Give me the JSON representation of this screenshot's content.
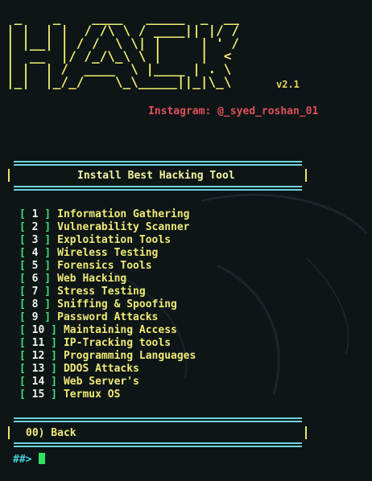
{
  "banner": {
    "ascii_lines": [
      " _    _    ____   _____  _  __",
      "| |  | |  / /\\ \\ / ____|| |/ /",
      "| |__| | / /  \\ \\| |     | ' / ",
      "|  __  |/ /_/\\_\\ \\ |     |  <  ",
      "| |  | /  ____  \\ |____ | . \\ ",
      "|_|  |_/_/    \\_\\_____||_|\\_\\"
    ],
    "version": "v2.1",
    "instagram": "Instagram: @_syed_roshan_01"
  },
  "header": {
    "title": "Install Best Hacking Tool"
  },
  "menu": {
    "items": [
      {
        "num": "1",
        "label": "Information Gathering"
      },
      {
        "num": "2",
        "label": "Vulnerability Scanner"
      },
      {
        "num": "3",
        "label": "Exploitation Tools"
      },
      {
        "num": "4",
        "label": "Wireless Testing"
      },
      {
        "num": "5",
        "label": "Forensics Tools"
      },
      {
        "num": "6",
        "label": "Web Hacking"
      },
      {
        "num": "7",
        "label": "Stress Testing"
      },
      {
        "num": "8",
        "label": "Sniffing & Spoofing"
      },
      {
        "num": "9",
        "label": "Password Attacks"
      },
      {
        "num": "10",
        "label": "Maintaining Access"
      },
      {
        "num": "11",
        "label": "IP-Tracking tools"
      },
      {
        "num": "12",
        "label": "Programming Languages"
      },
      {
        "num": "13",
        "label": "DDOS Attacks"
      },
      {
        "num": "14",
        "label": "Web Server's"
      },
      {
        "num": "15",
        "label": "Termux OS"
      }
    ]
  },
  "footer": {
    "back": "00) Back"
  },
  "prompt": {
    "text": "##>"
  },
  "colors": {
    "background": "#0d1516",
    "banner": "#f1f16e",
    "instagram": "#e0505a",
    "rule": "#6fd3dc",
    "bracket": "#3ee27a",
    "label": "#f0ea77",
    "prompt": "#3fd0e2",
    "cursor": "#2ee266"
  }
}
